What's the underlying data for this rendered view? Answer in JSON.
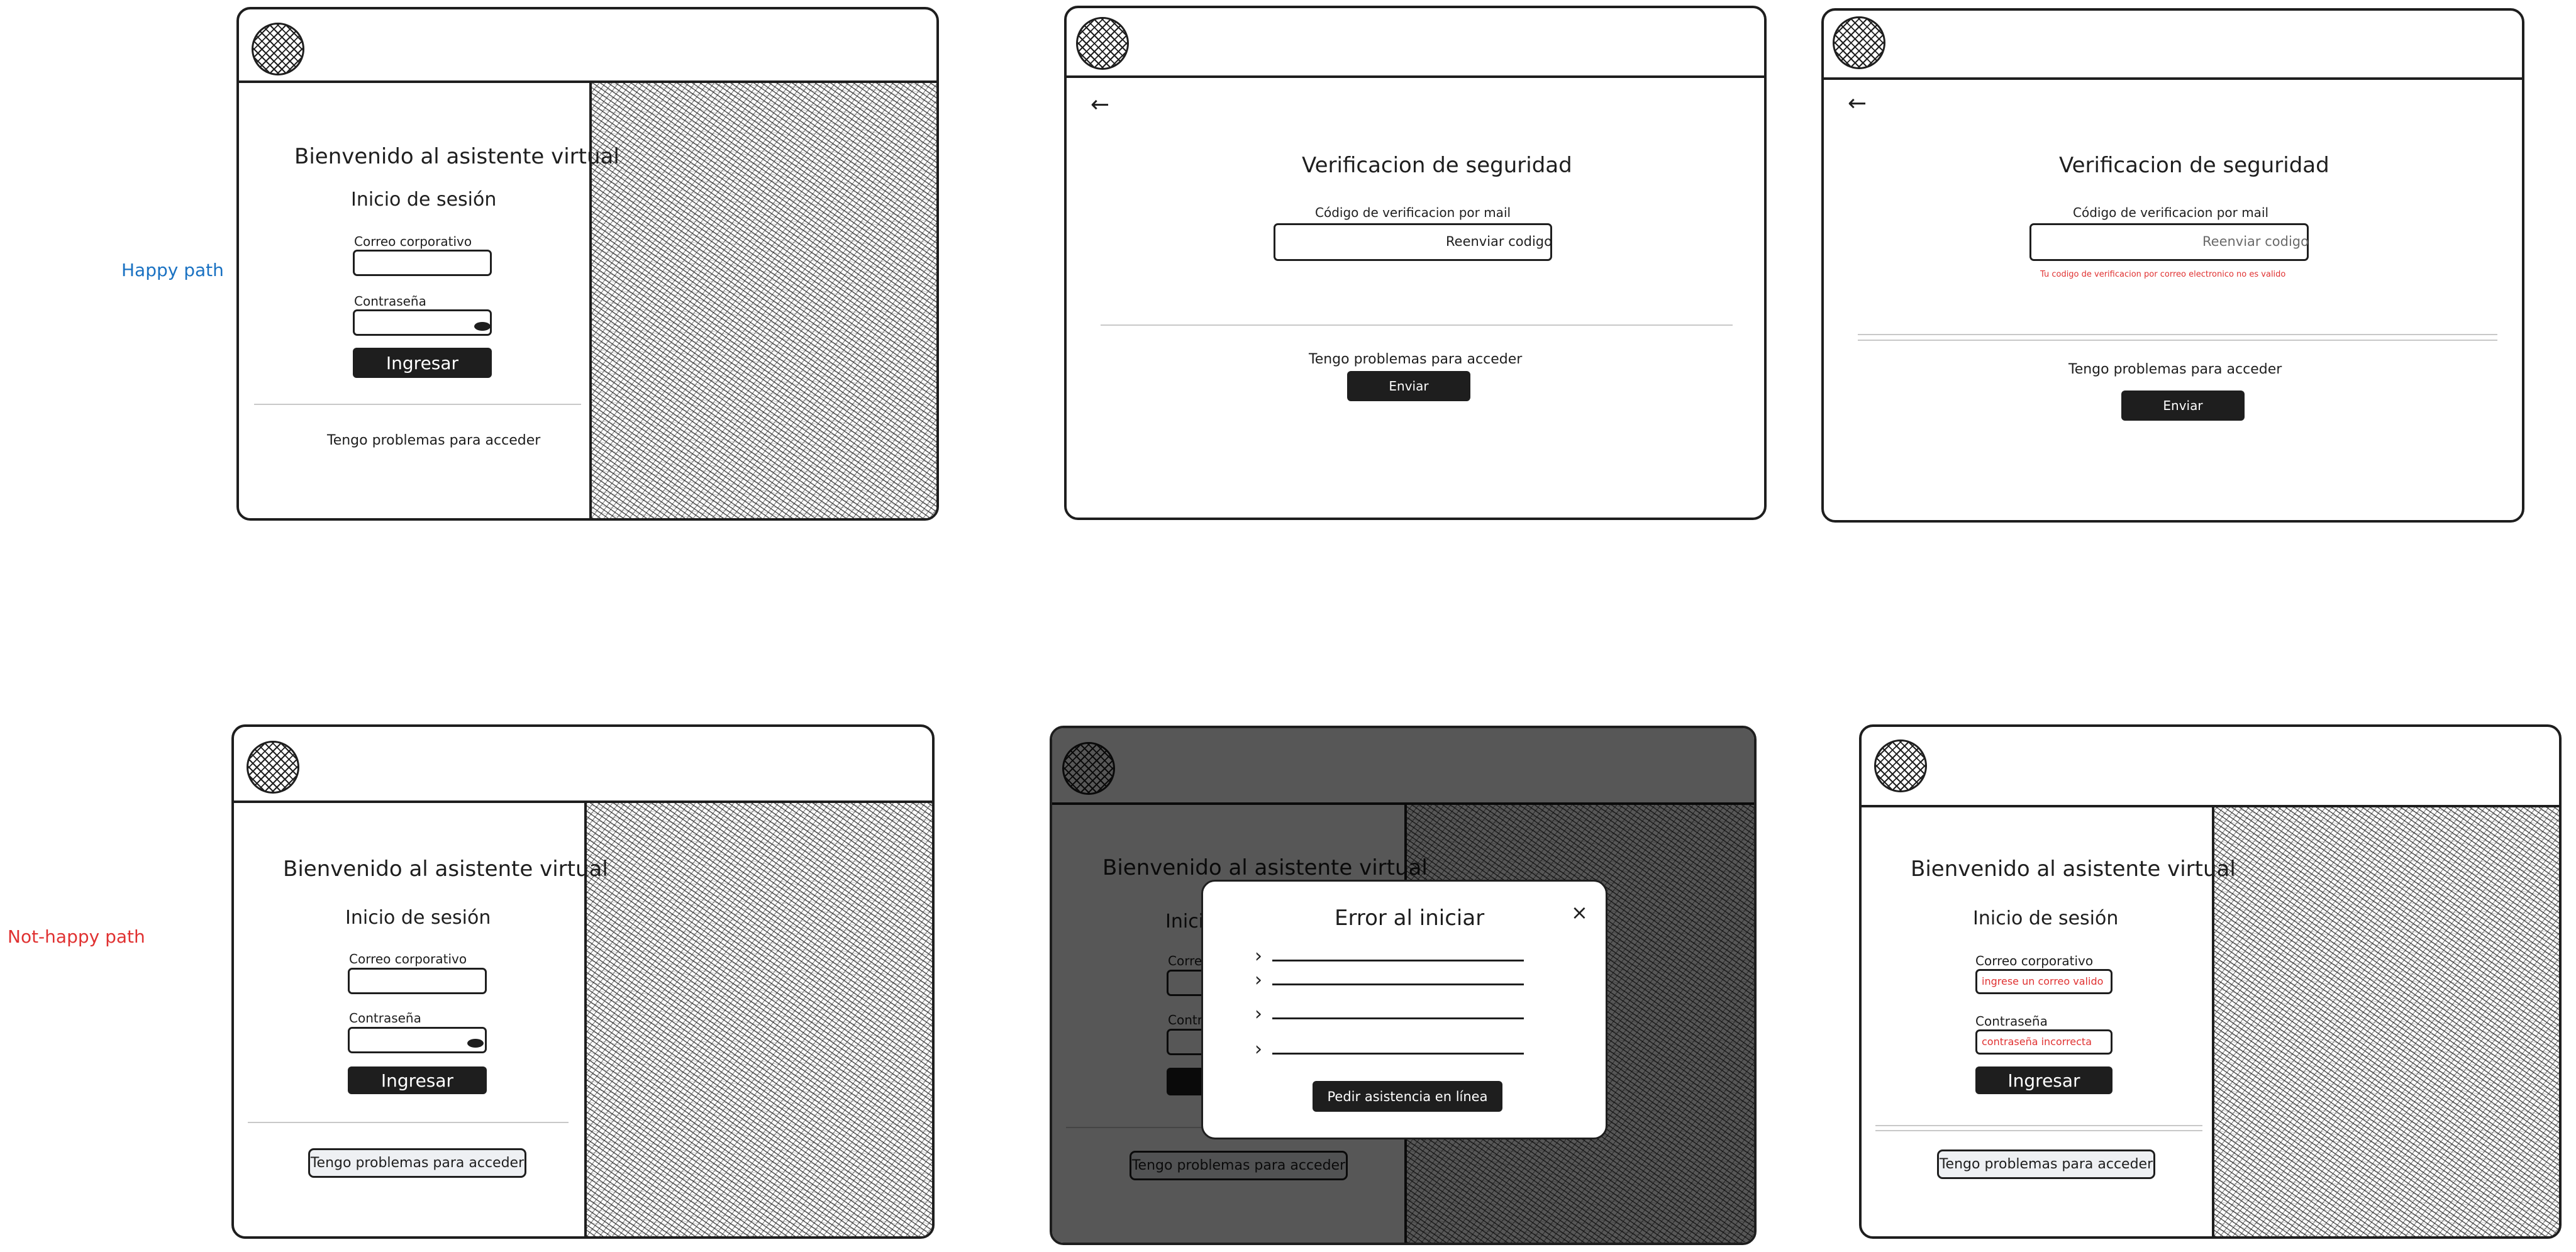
{
  "row_labels": {
    "happy": "Happy path",
    "not_happy": "Not-happy path"
  },
  "colors": {
    "happy_label": "#1971c2",
    "not_happy_label": "#e03131",
    "stroke": "#1e1e1e",
    "error": "#e03131",
    "overlay": "rgba(0,0,0,0.66)"
  },
  "login": {
    "welcome": "Bienvenido al asistente virtual",
    "title": "Inicio de sesión",
    "email_label": "Correo corporativo",
    "password_label": "Contraseña",
    "submit": "Ingresar",
    "help": "Tengo problemas para acceder"
  },
  "verification": {
    "back_icon": "arrow-left-icon",
    "title": "Verificacion de seguridad",
    "field_label": "Código de verificacion por mail",
    "resend": "Reenviar codigo",
    "help": "Tengo problemas para acceder",
    "send": "Enviar",
    "error": "Tu codigo de verificacion por correo electronico no es valido"
  },
  "error_modal": {
    "title": "Error al iniciar",
    "close": "×",
    "items": 4,
    "action": "Pedir asistencia en línea"
  },
  "validation": {
    "email_error": "ingrese un correo valido",
    "password_error": "contraseña incorrecta"
  },
  "icons": [
    "avatar-placeholder-icon",
    "eye-icon",
    "arrow-left-icon",
    "close-icon",
    "chevron-right-icon"
  ]
}
